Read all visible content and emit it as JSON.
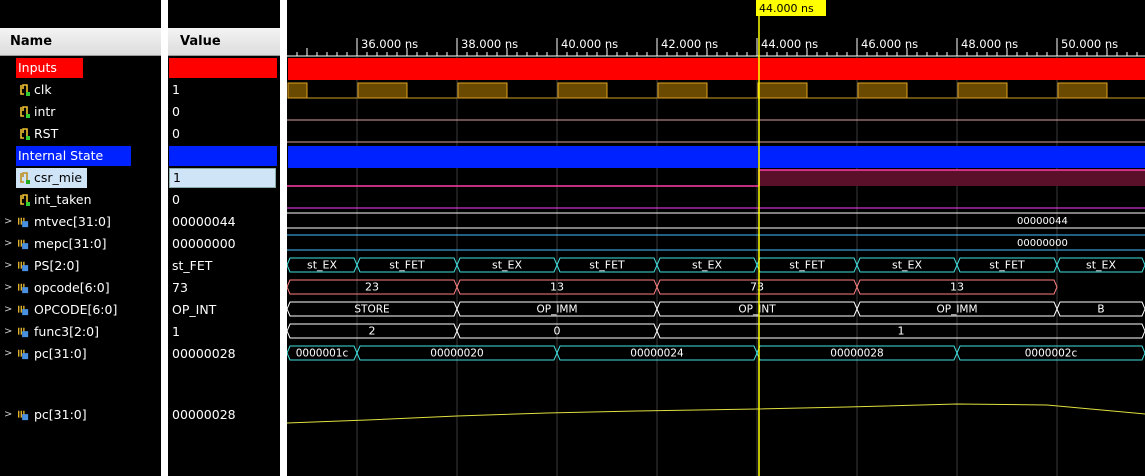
{
  "columns": {
    "name": "Name",
    "value": "Value"
  },
  "cursor": {
    "label": "44.000 ns"
  },
  "ruler": {
    "labels": [
      "36.000 ns",
      "38.000 ns",
      "40.000 ns",
      "42.000 ns",
      "44.000 ns",
      "46.000 ns",
      "48.000 ns",
      "50.000 ns"
    ]
  },
  "colors": {
    "inputs_group": "#ff0000",
    "internal_group": "#0022ff",
    "cursor": "#ffff00",
    "selected_row": "#d0e4f8"
  },
  "signals": [
    {
      "name": "Inputs",
      "value": "",
      "kind": "group"
    },
    {
      "name": "clk",
      "value": "1",
      "kind": "bit"
    },
    {
      "name": "intr",
      "value": "0",
      "kind": "bit"
    },
    {
      "name": "RST",
      "value": "0",
      "kind": "bit"
    },
    {
      "name": "Internal State",
      "value": "",
      "kind": "group"
    },
    {
      "name": "csr_mie",
      "value": "1",
      "kind": "bit"
    },
    {
      "name": "int_taken",
      "value": "0",
      "kind": "bit"
    },
    {
      "name": "mtvec[31:0]",
      "value": "00000044",
      "kind": "bus"
    },
    {
      "name": "mepc[31:0]",
      "value": "00000000",
      "kind": "bus"
    },
    {
      "name": "PS[2:0]",
      "value": "st_FET",
      "kind": "bus"
    },
    {
      "name": "opcode[6:0]",
      "value": "73",
      "kind": "bus"
    },
    {
      "name": "OPCODE[6:0]",
      "value": "OP_INT",
      "kind": "bus"
    },
    {
      "name": "func3[2:0]",
      "value": "1",
      "kind": "bus"
    },
    {
      "name": "pc[31:0]",
      "value": "00000028",
      "kind": "bus"
    },
    {
      "name": "pc[31:0]",
      "value": "00000028",
      "kind": "bus"
    }
  ],
  "waves": {
    "mtvec": [
      "00000044"
    ],
    "mepc": [
      "00000000"
    ],
    "ps": [
      "st_EX",
      "st_FET",
      "st_EX",
      "st_FET",
      "st_EX",
      "st_FET",
      "st_EX",
      "st_FET",
      "st_EX"
    ],
    "opcode": [
      "23",
      "13",
      "73",
      "13"
    ],
    "OPCODE": [
      "STORE",
      "OP_IMM",
      "OP_INT",
      "OP_IMM",
      "B"
    ],
    "func3": [
      "2",
      "0",
      "1"
    ],
    "pc": [
      "0000001c",
      "00000020",
      "00000024",
      "00000028",
      "0000002c"
    ]
  }
}
